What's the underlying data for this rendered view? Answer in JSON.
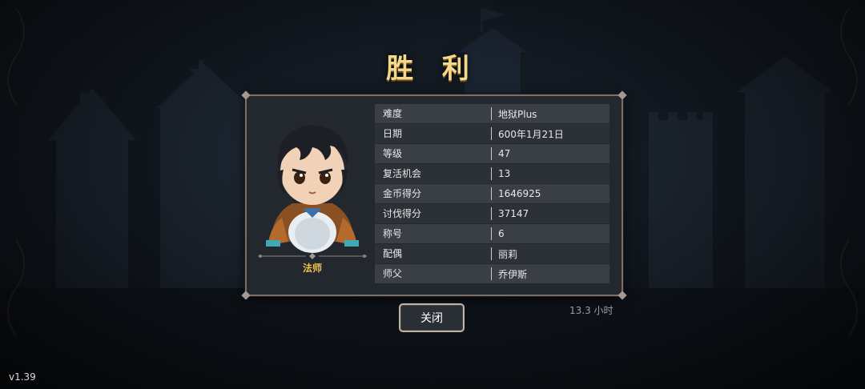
{
  "title": "胜 利",
  "character": {
    "class_label": "法师",
    "portrait_icon": "mage-character-portrait"
  },
  "stats": [
    {
      "key": "难度",
      "value": "地狱Plus"
    },
    {
      "key": "日期",
      "value": "600年1月21日"
    },
    {
      "key": "等级",
      "value": "47"
    },
    {
      "key": "复活机会",
      "value": "13"
    },
    {
      "key": "金币得分",
      "value": "1646925"
    },
    {
      "key": "讨伐得分",
      "value": "37147"
    },
    {
      "key": "称号",
      "value": "6"
    },
    {
      "key": "配偶",
      "value": "丽莉"
    },
    {
      "key": "师父",
      "value": "乔伊斯"
    }
  ],
  "close_label": "关闭",
  "play_time": "13.3 小时",
  "version": "v1.39",
  "colors": {
    "title": "#f5d98a",
    "class_label": "#f0c24b",
    "panel_bg": "#23272e"
  }
}
